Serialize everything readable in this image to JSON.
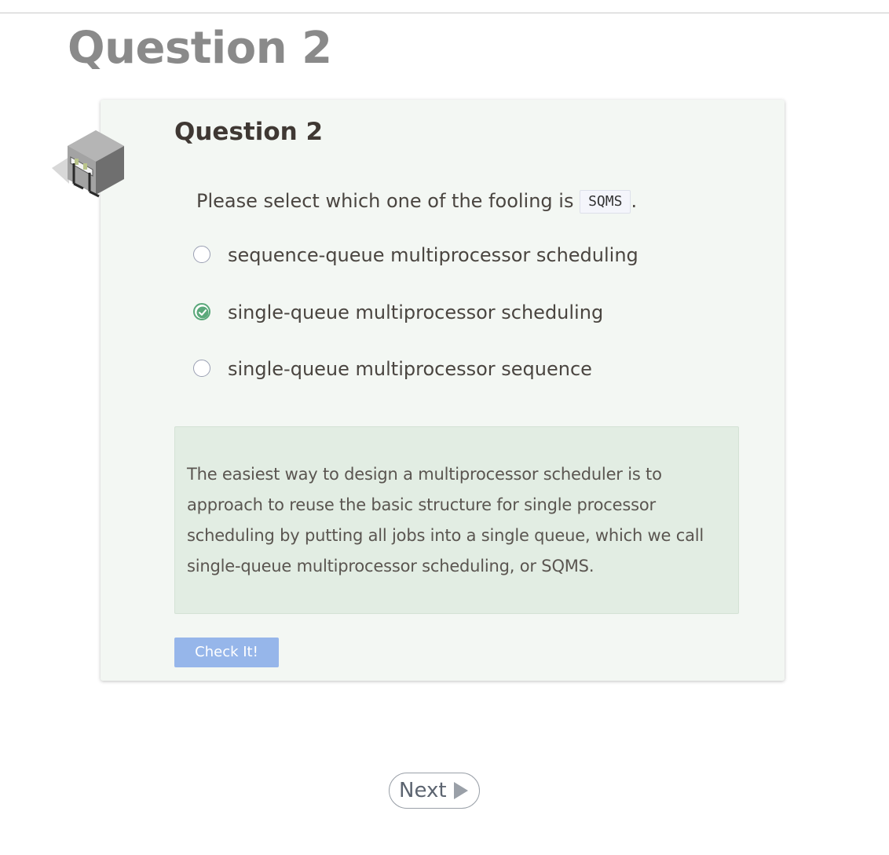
{
  "page": {
    "title": "Question 2"
  },
  "quiz": {
    "title": "Question 2",
    "prompt_text": "Please select which one of the fooling is ",
    "prompt_code": "SQMS",
    "prompt_suffix": ".",
    "options": [
      {
        "label": "sequence-queue multiprocessor scheduling",
        "selected": false
      },
      {
        "label": "single-queue multiprocessor scheduling",
        "selected": true
      },
      {
        "label": "single-queue multiprocessor sequence",
        "selected": false
      }
    ],
    "feedback": "The easiest way to design a multiprocessor scheduler is to approach to reuse the basic structure for single processor scheduling by putting all jobs into a single queue, which we call single-queue multiprocessor scheduling, or SQMS.",
    "check_button_label": "Check It!",
    "icon": "quiz-hurdle-cube-icon"
  },
  "navigation": {
    "next_label": "Next",
    "next_icon": "play-arrow-icon"
  },
  "colors": {
    "card_background": "#f3f7f3",
    "feedback_background": "#e2ede3",
    "check_button": "#96b6ea",
    "selected_radio": "#5aa87a",
    "page_title": "#8a8a8a"
  }
}
